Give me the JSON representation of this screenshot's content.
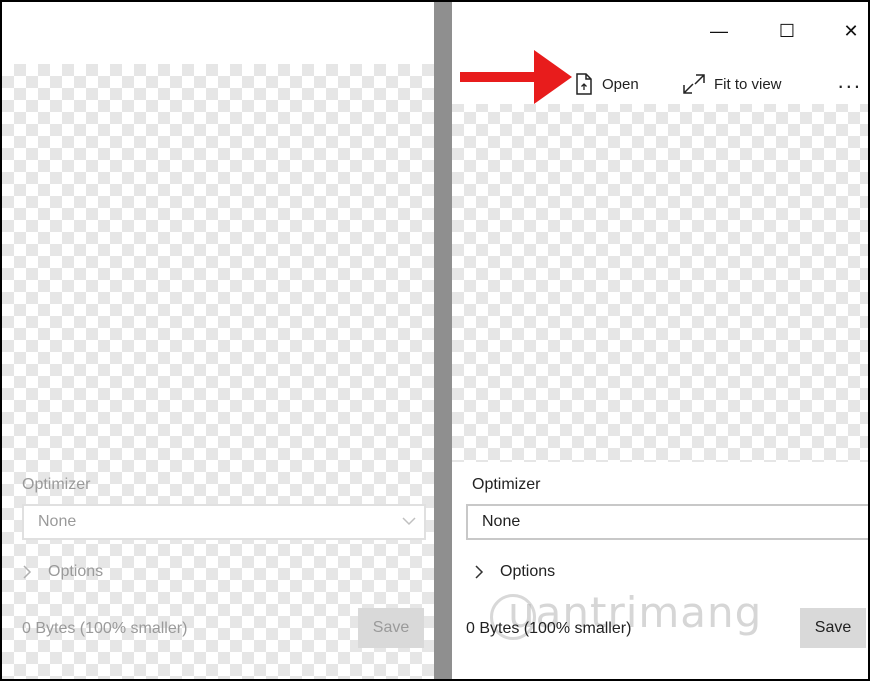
{
  "left_pane": {
    "optimizer_label": "Optimizer",
    "select_value": "None",
    "options_label": "Options",
    "size_text": "0 Bytes (100% smaller)",
    "save_label": "Save"
  },
  "right_pane": {
    "window_controls": {
      "minimize": "—",
      "maximize": "☐",
      "close": "✕"
    },
    "toolbar": {
      "open_label": "Open",
      "fit_label": "Fit to view",
      "more_label": "..."
    },
    "optimizer_label": "Optimizer",
    "select_value": "None",
    "options_label": "Options",
    "size_text": "0 Bytes (100% smaller)",
    "save_label": "Save",
    "watermark": "uantrimang"
  },
  "colors": {
    "arrow": "#e81c1c",
    "divider": "#8f8f8f",
    "save_bg": "#d9d9d9"
  },
  "icons": [
    "open-file-icon",
    "fit-to-view-icon",
    "chevron-down-icon",
    "chevron-right-icon",
    "red-arrow-annotation"
  ]
}
